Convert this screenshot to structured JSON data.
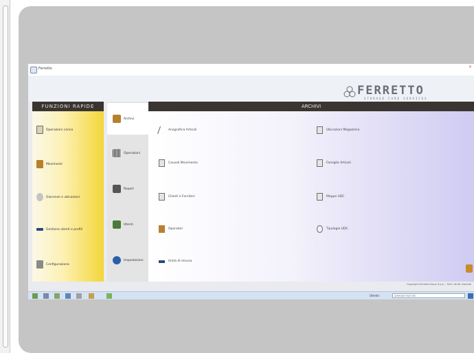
{
  "window": {
    "title": "Ferretto",
    "close_glyph": "×"
  },
  "logo": {
    "name": "FERRETTO",
    "tagline": "STORAGE CARE SERVICES"
  },
  "sidebar": {
    "header": "FUNZIONI RAPIDE",
    "items": [
      {
        "label": "Operazioni carico",
        "icon": "document-icon",
        "color": "#d9d2b8"
      },
      {
        "label": "Movimenti",
        "icon": "box-icon",
        "color": "#b8802d"
      },
      {
        "label": "Giacenze e ubicazioni",
        "icon": "search-icon",
        "color": "#c4c4c4"
      },
      {
        "label": "Gestione utenti e profili",
        "icon": "key-icon",
        "color": "#2a4a7c"
      },
      {
        "label": "Configurazione",
        "icon": "settings-icon",
        "color": "#8a8a8a"
      }
    ]
  },
  "tabs": [
    {
      "label": "Archivi",
      "icon": "box-icon",
      "color": "#b8802d",
      "active": true
    },
    {
      "label": "Operazioni",
      "icon": "barcode-icon",
      "color": "#333333",
      "active": false
    },
    {
      "label": "Report",
      "icon": "forklift-icon",
      "color": "#555555",
      "active": false
    },
    {
      "label": "Utenti",
      "icon": "people-icon",
      "color": "#4c7a3a",
      "active": false
    },
    {
      "label": "Impostazioni",
      "icon": "globe-icon",
      "color": "#2b5fa8",
      "active": false
    }
  ],
  "content": {
    "header": "ARCHIVI",
    "items": [
      {
        "label": "Anagrafica Articoli",
        "icon": "pencil-icon"
      },
      {
        "label": "Ubicazioni Magazzino",
        "icon": "document-icon"
      },
      {
        "label": "Causali Movimento",
        "icon": "document-icon"
      },
      {
        "label": "Famiglie Articoli",
        "icon": "document-icon"
      },
      {
        "label": "Clienti e Fornitori",
        "icon": "document-icon"
      },
      {
        "label": "Mappe UDC",
        "icon": "document-icon"
      },
      {
        "label": "Operatori",
        "icon": "box-icon"
      },
      {
        "label": "Tipologie UDC",
        "icon": "search-icon"
      },
      {
        "label": "Unità di misura",
        "icon": "key-icon"
      }
    ]
  },
  "footer": {
    "text": "Copyright Ferretto Group S.p.A. - Tutti i diritti riservati"
  },
  "statusbar": {
    "label": "Utente:",
    "field_value": "AMMINISTRATORE"
  }
}
